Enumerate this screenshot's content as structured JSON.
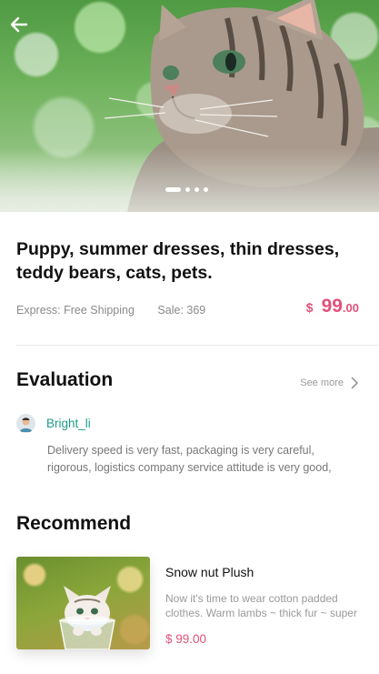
{
  "hero": {
    "image_icon": "cat-photo",
    "back_icon": "arrow-left-icon",
    "carousel_dots": 4,
    "active_dot": 0
  },
  "product": {
    "title": "Puppy, summer dresses, thin dresses, teddy bears, cats, pets.",
    "shipping": "Express: Free Shipping",
    "sale": "Sale: 369",
    "price_currency": "$",
    "price_integer": "99",
    "price_decimal": ".00"
  },
  "evaluation": {
    "heading": "Evaluation",
    "see_more": "See more",
    "reviewer_name": "Bright_li",
    "review_text": "Delivery speed is very fast, packaging is very careful, rigorous, logistics company service attitude is very good, transportation is fast."
  },
  "recommend": {
    "heading": "Recommend",
    "item": {
      "title": "Snow nut Plush",
      "description": "Now it's time to wear cotton padded clothes. Warm lambs ~ thick fur ~ super",
      "price": "$ 99.00"
    }
  },
  "colors": {
    "accent_pink": "#e0517a",
    "accent_teal": "#1f9a8a"
  }
}
